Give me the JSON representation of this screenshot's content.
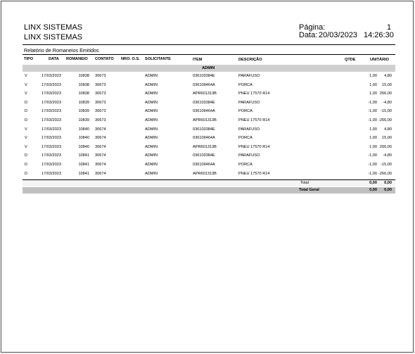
{
  "header": {
    "company_line1": "LINX SISTEMAS",
    "company_line2": "LINX SISTEMAS",
    "page_label": "Página:",
    "page_number": "1",
    "date_label": "Data:",
    "date": "20/03/2023",
    "time": "14:26:30"
  },
  "report_title": "Relatório de Romaneios Emitidos",
  "columns": {
    "tipo": "TIPO",
    "data": "DATA",
    "romaneio": "ROMANEIO",
    "contato": "CONTATO",
    "nro_os": "NRO. O.S.",
    "solicitante": "SOLICITANTE",
    "item": "ITEM",
    "descricao": "DESCRIÇÃO",
    "qtde": "QTDE",
    "unitario": "UNITÁRIO"
  },
  "group_label": "ADMIN",
  "rows": [
    {
      "tipo": "V",
      "data": "17/03/2023",
      "romaneio": "10838",
      "contato": "30673",
      "solicitante": "ADMIN",
      "item": "036103384E",
      "descricao": "PARAFUSO",
      "qtde": "1,00",
      "unitario": "4,80"
    },
    {
      "tipo": "V",
      "data": "17/03/2023",
      "romaneio": "10838",
      "contato": "30673",
      "solicitante": "ADMIN",
      "item": "036109464A",
      "descricao": "PORCA",
      "qtde": "1,00",
      "unitario": "15,00"
    },
    {
      "tipo": "V",
      "data": "17/03/2023",
      "romaneio": "10838",
      "contato": "30673",
      "solicitante": "ADMIN",
      "item": "APR601313B",
      "descricao": "PNEU 17570 R14",
      "qtde": "1,00",
      "unitario": "266,00"
    },
    {
      "tipo": "D",
      "data": "17/03/2023",
      "romaneio": "10839",
      "contato": "30673",
      "solicitante": "ADMIN",
      "item": "036103384E",
      "descricao": "PARAFUSO",
      "qtde": "-1,00",
      "unitario": "-4,80"
    },
    {
      "tipo": "D",
      "data": "17/03/2023",
      "romaneio": "10839",
      "contato": "30673",
      "solicitante": "ADMIN",
      "item": "036109464A",
      "descricao": "PORCA",
      "qtde": "-1,00",
      "unitario": "-15,00"
    },
    {
      "tipo": "D",
      "data": "17/03/2023",
      "romaneio": "10839",
      "contato": "30673",
      "solicitante": "ADMIN",
      "item": "APR601313B",
      "descricao": "PNEU 17570 R14",
      "qtde": "-1,00",
      "unitario": "-266,00"
    },
    {
      "tipo": "V",
      "data": "17/03/2023",
      "romaneio": "10840",
      "contato": "30674",
      "solicitante": "ADMIN",
      "item": "036103384E",
      "descricao": "PARAFUSO",
      "qtde": "1,00",
      "unitario": "4,80"
    },
    {
      "tipo": "V",
      "data": "17/03/2023",
      "romaneio": "10840",
      "contato": "30674",
      "solicitante": "ADMIN",
      "item": "036109464A",
      "descricao": "PORCA",
      "qtde": "1,00",
      "unitario": "15,00"
    },
    {
      "tipo": "V",
      "data": "17/03/2023",
      "romaneio": "10840",
      "contato": "30674",
      "solicitante": "ADMIN",
      "item": "APR601313B",
      "descricao": "PNEU 17570 R14",
      "qtde": "1,00",
      "unitario": "266,00"
    },
    {
      "tipo": "D",
      "data": "17/03/2023",
      "romaneio": "10841",
      "contato": "30674",
      "solicitante": "ADMIN",
      "item": "036103384E",
      "descricao": "PARAFUSO",
      "qtde": "-1,00",
      "unitario": "-4,80"
    },
    {
      "tipo": "D",
      "data": "17/03/2023",
      "romaneio": "10841",
      "contato": "30674",
      "solicitante": "ADMIN",
      "item": "036109464A",
      "descricao": "PORCA",
      "qtde": "-1,00",
      "unitario": "-15,00"
    },
    {
      "tipo": "D",
      "data": "17/03/2023",
      "romaneio": "10841",
      "contato": "30674",
      "solicitante": "ADMIN",
      "item": "APR601313B",
      "descricao": "PNEU 17570 R14",
      "qtde": "-1,00",
      "unitario": "-266,00"
    }
  ],
  "total": {
    "label": "Total",
    "qtde": "0,00",
    "unitario": "0,00"
  },
  "total_geral": {
    "label": "Total Geral",
    "qtde": "0,00",
    "unitario": "0,00"
  }
}
